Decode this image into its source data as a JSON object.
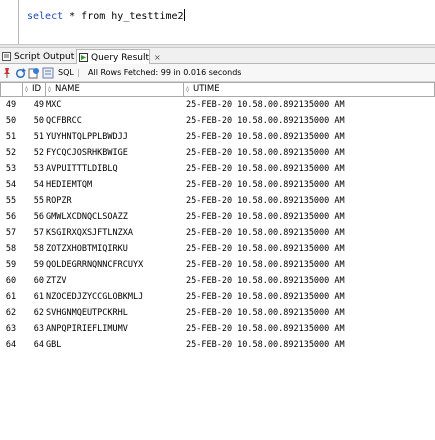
{
  "editor": {
    "keyword": "select",
    "rest": " * from hy_testtime2"
  },
  "tabs": [
    {
      "label": "Script Output",
      "close": "×",
      "icon": "script-icon"
    },
    {
      "label": "Query Result",
      "close": "×",
      "icon": "query-result-icon"
    }
  ],
  "toolbar": {
    "sql_label": "SQL",
    "separator": "|",
    "status": "All Rows Fetched: 99 in 0.016 seconds"
  },
  "grid": {
    "columns": [
      "ID",
      "NAME",
      "UTIME"
    ],
    "rows": [
      {
        "rownum": "49",
        "id": "49",
        "name": "MXC",
        "utime": "25-FEB-20 10.58.00.892135000 AM"
      },
      {
        "rownum": "50",
        "id": "50",
        "name": "QCFBRCC",
        "utime": "25-FEB-20 10.58.00.892135000 AM"
      },
      {
        "rownum": "51",
        "id": "51",
        "name": "YUYHNTQLPPLBWDJJ",
        "utime": "25-FEB-20 10.58.00.892135000 AM"
      },
      {
        "rownum": "52",
        "id": "52",
        "name": "FYCQCJOSRHKBWIGE",
        "utime": "25-FEB-20 10.58.00.892135000 AM"
      },
      {
        "rownum": "53",
        "id": "53",
        "name": "AVPUITTTLDIBLQ",
        "utime": "25-FEB-20 10.58.00.892135000 AM"
      },
      {
        "rownum": "54",
        "id": "54",
        "name": "HEDIEMTQM",
        "utime": "25-FEB-20 10.58.00.892135000 AM"
      },
      {
        "rownum": "55",
        "id": "55",
        "name": "ROPZR",
        "utime": "25-FEB-20 10.58.00.892135000 AM"
      },
      {
        "rownum": "56",
        "id": "56",
        "name": "GMWLXCDNQCLSOAZZ",
        "utime": "25-FEB-20 10.58.00.892135000 AM"
      },
      {
        "rownum": "57",
        "id": "57",
        "name": "KSGIRXQXSJFTLNZXA",
        "utime": "25-FEB-20 10.58.00.892135000 AM"
      },
      {
        "rownum": "58",
        "id": "58",
        "name": "ZOTZXHOBTMIQIRKU",
        "utime": "25-FEB-20 10.58.00.892135000 AM"
      },
      {
        "rownum": "59",
        "id": "59",
        "name": "QOLDEGRRNQNNCFRCUYX",
        "utime": "25-FEB-20 10.58.00.892135000 AM"
      },
      {
        "rownum": "60",
        "id": "60",
        "name": "ZTZV",
        "utime": "25-FEB-20 10.58.00.892135000 AM"
      },
      {
        "rownum": "61",
        "id": "61",
        "name": "NZOCEDJZYCCGLOBKMLJ",
        "utime": "25-FEB-20 10.58.00.892135000 AM"
      },
      {
        "rownum": "62",
        "id": "62",
        "name": "SVHGNMQEUTPCKRHL",
        "utime": "25-FEB-20 10.58.00.892135000 AM"
      },
      {
        "rownum": "63",
        "id": "63",
        "name": "ANPQPIRIEFLIMUMV",
        "utime": "25-FEB-20 10.58.00.892135000 AM"
      },
      {
        "rownum": "64",
        "id": "64",
        "name": "GBL",
        "utime": "25-FEB-20 10.58.00.892135000 AM"
      }
    ]
  },
  "colors": {
    "keyword": "#1e4bb5",
    "tab_bar": "#f0f0f0",
    "grid_border": "#a9a9a9"
  }
}
